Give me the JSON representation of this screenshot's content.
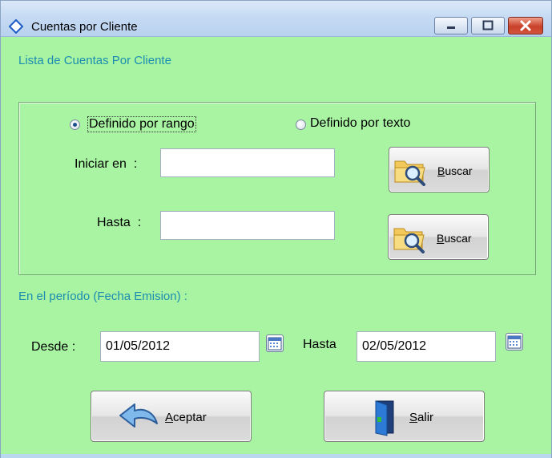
{
  "window": {
    "title": "Cuentas por Cliente"
  },
  "titlebar_buttons": {
    "minimize": "minimize-icon",
    "maximize": "maximize-icon",
    "close": "close-icon"
  },
  "heading": "Lista de Cuentas Por Cliente",
  "range_panel": {
    "options": [
      {
        "label": "Definido por rango",
        "selected": true
      },
      {
        "label": "Definido por texto",
        "selected": false
      }
    ],
    "start_label": "Iniciar en  :",
    "start_value": "",
    "end_label": "Hasta  :",
    "end_value": "",
    "search_button": "Buscar",
    "search_icon": "folder-search-icon"
  },
  "period": {
    "label": "En el período (Fecha Emision) :",
    "from_label": "Desde :",
    "from_value": "01/05/2012",
    "to_label": "Hasta",
    "to_value": "02/05/2012",
    "calendar_icon": "calendar-icon"
  },
  "actions": {
    "accept": "Aceptar",
    "accept_icon": "back-arrow-icon",
    "exit": "Salir",
    "exit_icon": "door-exit-icon"
  },
  "colors": {
    "background": "#a8f4a2",
    "accent_text": "#1c8db0",
    "titlebar": "#c6dbf3",
    "close": "#c8412a"
  }
}
